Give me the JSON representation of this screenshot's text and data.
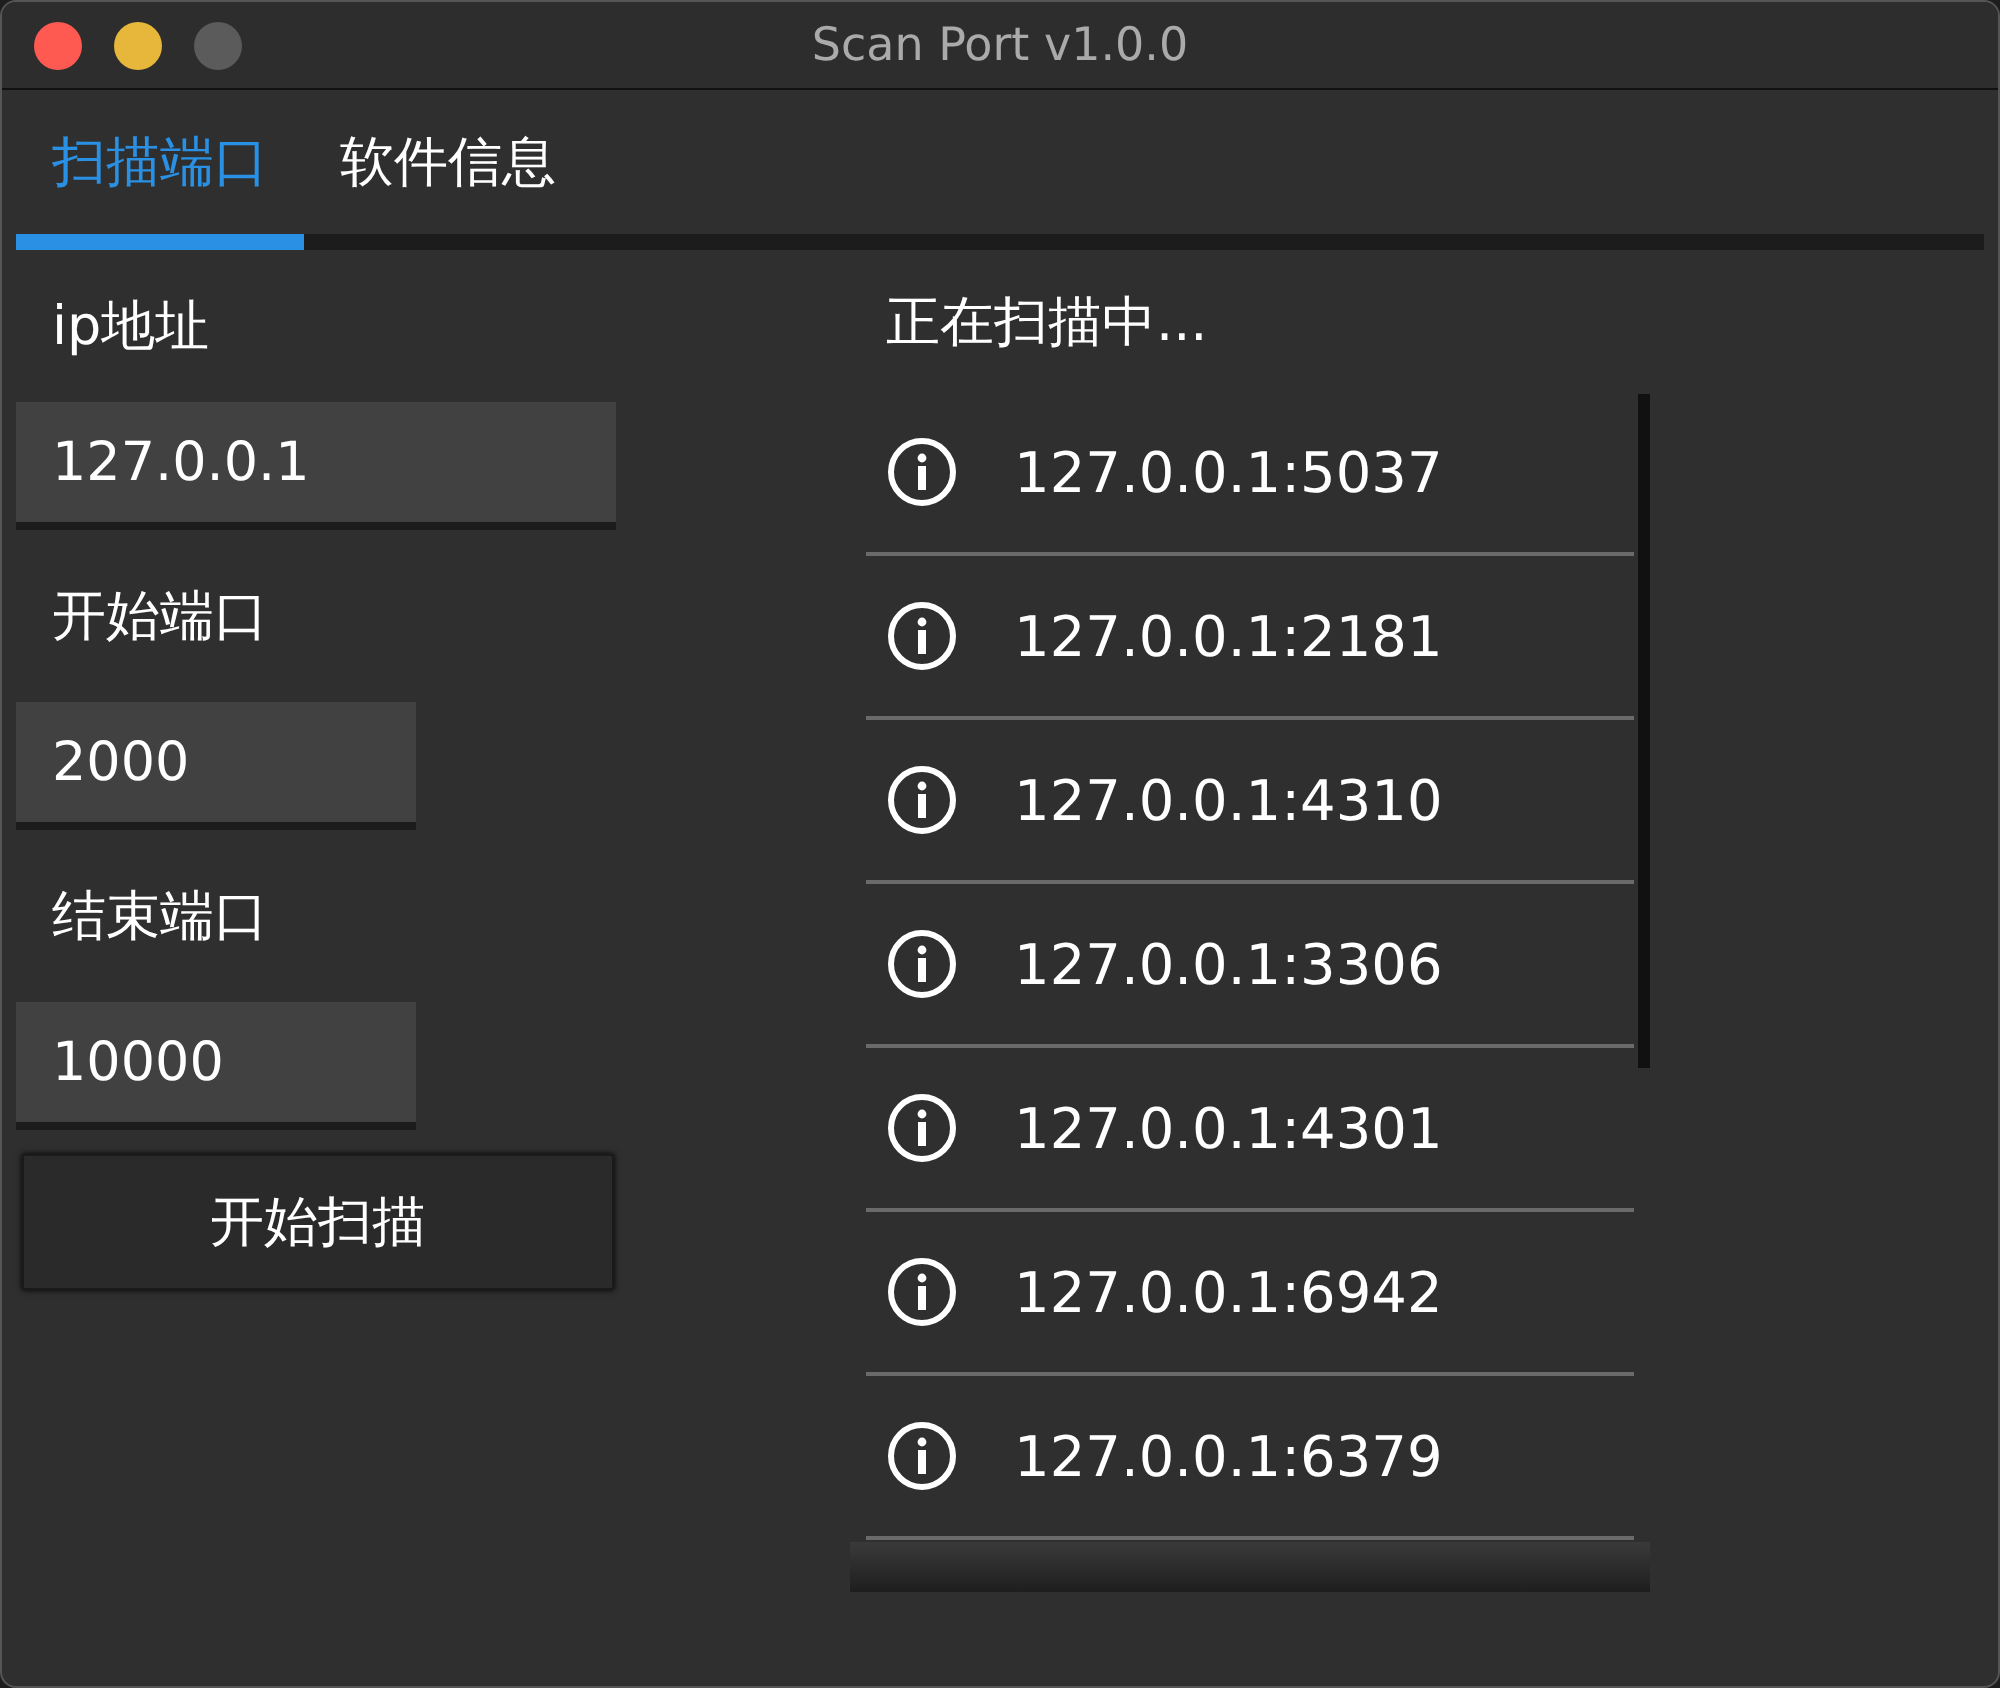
{
  "window": {
    "title": "Scan Port v1.0.0"
  },
  "tabs": [
    {
      "label": "扫描端口",
      "selected": true
    },
    {
      "label": "软件信息",
      "selected": false
    }
  ],
  "form": {
    "fields": [
      {
        "label": "ip地址",
        "value": "127.0.0.1"
      },
      {
        "label": "开始端口",
        "value": "2000"
      },
      {
        "label": "结束端口",
        "value": "10000"
      }
    ],
    "button": "开始扫描"
  },
  "results": {
    "heading": "正在扫描中...",
    "items": [
      "127.0.0.1:5037",
      "127.0.0.1:2181",
      "127.0.0.1:4310",
      "127.0.0.1:3306",
      "127.0.0.1:4301",
      "127.0.0.1:6942",
      "127.0.0.1:6379"
    ]
  }
}
